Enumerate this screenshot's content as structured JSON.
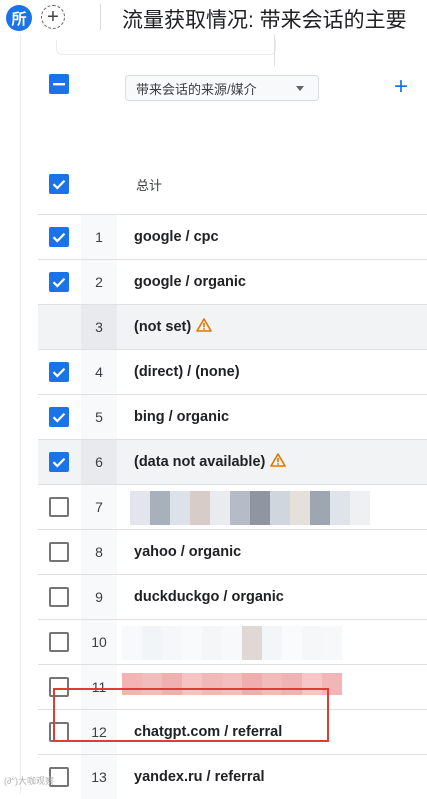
{
  "topbar": {
    "badge": "所",
    "add_symbol": "+",
    "title": "流量获取情况: 带来会话的主要"
  },
  "header": {
    "dimension_label": "带来会话的来源/媒介",
    "add_symbol": "+",
    "total_label": "总计",
    "header_checkbox_state": "indeterminate",
    "total_checkbox_state": "checked"
  },
  "rows": [
    {
      "rank": "1",
      "label": "google / cpc",
      "checked": true,
      "warning": false,
      "redacted": false
    },
    {
      "rank": "2",
      "label": "google / organic",
      "checked": true,
      "warning": false,
      "redacted": false
    },
    {
      "rank": "3",
      "label": "(not set)",
      "checked": null,
      "warning": true,
      "redacted": false
    },
    {
      "rank": "4",
      "label": "(direct) / (none)",
      "checked": true,
      "warning": false,
      "redacted": false
    },
    {
      "rank": "5",
      "label": "bing / organic",
      "checked": true,
      "warning": false,
      "redacted": false
    },
    {
      "rank": "6",
      "label": "(data not available)",
      "checked": true,
      "warning": true,
      "redacted": false
    },
    {
      "rank": "7",
      "label": "",
      "checked": false,
      "warning": false,
      "redacted": true
    },
    {
      "rank": "8",
      "label": "yahoo / organic",
      "checked": false,
      "warning": false,
      "redacted": false
    },
    {
      "rank": "9",
      "label": "duckduckgo / organic",
      "checked": false,
      "warning": false,
      "redacted": false
    },
    {
      "rank": "10",
      "label": "",
      "checked": false,
      "warning": false,
      "redacted": true
    },
    {
      "rank": "11",
      "label": "",
      "checked": false,
      "warning": false,
      "redacted": true
    },
    {
      "rank": "12",
      "label": "chatgpt.com / referral",
      "checked": false,
      "warning": false,
      "redacted": false
    },
    {
      "rank": "13",
      "label": "yandex.ru / referral",
      "checked": false,
      "warning": false,
      "redacted": false
    }
  ],
  "colors": {
    "accent": "#1a73e8",
    "warning": "#e37400",
    "highlight": "#e53935"
  },
  "watermark": "(∂°)大咖观察"
}
